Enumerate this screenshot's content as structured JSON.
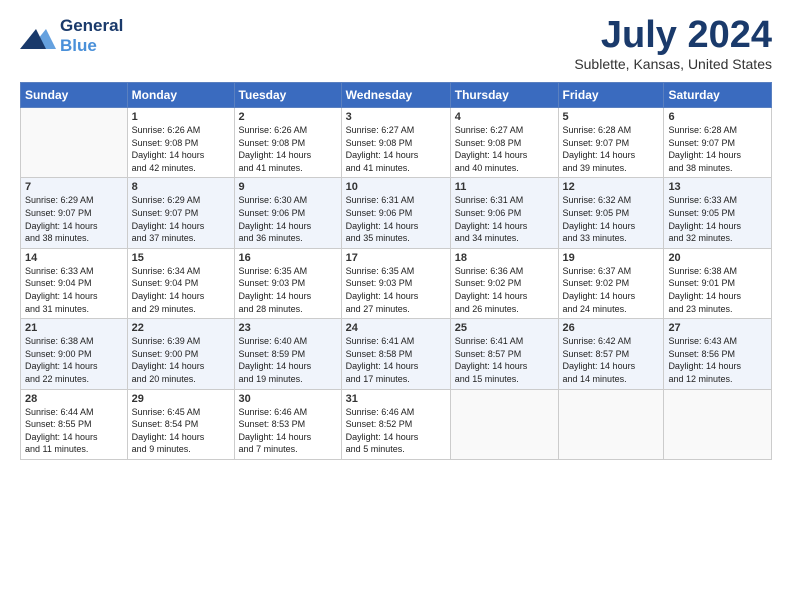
{
  "header": {
    "logo_line1": "General",
    "logo_line2": "Blue",
    "title": "July 2024",
    "location": "Sublette, Kansas, United States"
  },
  "days_of_week": [
    "Sunday",
    "Monday",
    "Tuesday",
    "Wednesday",
    "Thursday",
    "Friday",
    "Saturday"
  ],
  "weeks": [
    [
      {
        "day": "",
        "info": ""
      },
      {
        "day": "1",
        "info": "Sunrise: 6:26 AM\nSunset: 9:08 PM\nDaylight: 14 hours\nand 42 minutes."
      },
      {
        "day": "2",
        "info": "Sunrise: 6:26 AM\nSunset: 9:08 PM\nDaylight: 14 hours\nand 41 minutes."
      },
      {
        "day": "3",
        "info": "Sunrise: 6:27 AM\nSunset: 9:08 PM\nDaylight: 14 hours\nand 41 minutes."
      },
      {
        "day": "4",
        "info": "Sunrise: 6:27 AM\nSunset: 9:08 PM\nDaylight: 14 hours\nand 40 minutes."
      },
      {
        "day": "5",
        "info": "Sunrise: 6:28 AM\nSunset: 9:07 PM\nDaylight: 14 hours\nand 39 minutes."
      },
      {
        "day": "6",
        "info": "Sunrise: 6:28 AM\nSunset: 9:07 PM\nDaylight: 14 hours\nand 38 minutes."
      }
    ],
    [
      {
        "day": "7",
        "info": "Sunrise: 6:29 AM\nSunset: 9:07 PM\nDaylight: 14 hours\nand 38 minutes."
      },
      {
        "day": "8",
        "info": "Sunrise: 6:29 AM\nSunset: 9:07 PM\nDaylight: 14 hours\nand 37 minutes."
      },
      {
        "day": "9",
        "info": "Sunrise: 6:30 AM\nSunset: 9:06 PM\nDaylight: 14 hours\nand 36 minutes."
      },
      {
        "day": "10",
        "info": "Sunrise: 6:31 AM\nSunset: 9:06 PM\nDaylight: 14 hours\nand 35 minutes."
      },
      {
        "day": "11",
        "info": "Sunrise: 6:31 AM\nSunset: 9:06 PM\nDaylight: 14 hours\nand 34 minutes."
      },
      {
        "day": "12",
        "info": "Sunrise: 6:32 AM\nSunset: 9:05 PM\nDaylight: 14 hours\nand 33 minutes."
      },
      {
        "day": "13",
        "info": "Sunrise: 6:33 AM\nSunset: 9:05 PM\nDaylight: 14 hours\nand 32 minutes."
      }
    ],
    [
      {
        "day": "14",
        "info": "Sunrise: 6:33 AM\nSunset: 9:04 PM\nDaylight: 14 hours\nand 31 minutes."
      },
      {
        "day": "15",
        "info": "Sunrise: 6:34 AM\nSunset: 9:04 PM\nDaylight: 14 hours\nand 29 minutes."
      },
      {
        "day": "16",
        "info": "Sunrise: 6:35 AM\nSunset: 9:03 PM\nDaylight: 14 hours\nand 28 minutes."
      },
      {
        "day": "17",
        "info": "Sunrise: 6:35 AM\nSunset: 9:03 PM\nDaylight: 14 hours\nand 27 minutes."
      },
      {
        "day": "18",
        "info": "Sunrise: 6:36 AM\nSunset: 9:02 PM\nDaylight: 14 hours\nand 26 minutes."
      },
      {
        "day": "19",
        "info": "Sunrise: 6:37 AM\nSunset: 9:02 PM\nDaylight: 14 hours\nand 24 minutes."
      },
      {
        "day": "20",
        "info": "Sunrise: 6:38 AM\nSunset: 9:01 PM\nDaylight: 14 hours\nand 23 minutes."
      }
    ],
    [
      {
        "day": "21",
        "info": "Sunrise: 6:38 AM\nSunset: 9:00 PM\nDaylight: 14 hours\nand 22 minutes."
      },
      {
        "day": "22",
        "info": "Sunrise: 6:39 AM\nSunset: 9:00 PM\nDaylight: 14 hours\nand 20 minutes."
      },
      {
        "day": "23",
        "info": "Sunrise: 6:40 AM\nSunset: 8:59 PM\nDaylight: 14 hours\nand 19 minutes."
      },
      {
        "day": "24",
        "info": "Sunrise: 6:41 AM\nSunset: 8:58 PM\nDaylight: 14 hours\nand 17 minutes."
      },
      {
        "day": "25",
        "info": "Sunrise: 6:41 AM\nSunset: 8:57 PM\nDaylight: 14 hours\nand 15 minutes."
      },
      {
        "day": "26",
        "info": "Sunrise: 6:42 AM\nSunset: 8:57 PM\nDaylight: 14 hours\nand 14 minutes."
      },
      {
        "day": "27",
        "info": "Sunrise: 6:43 AM\nSunset: 8:56 PM\nDaylight: 14 hours\nand 12 minutes."
      }
    ],
    [
      {
        "day": "28",
        "info": "Sunrise: 6:44 AM\nSunset: 8:55 PM\nDaylight: 14 hours\nand 11 minutes."
      },
      {
        "day": "29",
        "info": "Sunrise: 6:45 AM\nSunset: 8:54 PM\nDaylight: 14 hours\nand 9 minutes."
      },
      {
        "day": "30",
        "info": "Sunrise: 6:46 AM\nSunset: 8:53 PM\nDaylight: 14 hours\nand 7 minutes."
      },
      {
        "day": "31",
        "info": "Sunrise: 6:46 AM\nSunset: 8:52 PM\nDaylight: 14 hours\nand 5 minutes."
      },
      {
        "day": "",
        "info": ""
      },
      {
        "day": "",
        "info": ""
      },
      {
        "day": "",
        "info": ""
      }
    ]
  ]
}
